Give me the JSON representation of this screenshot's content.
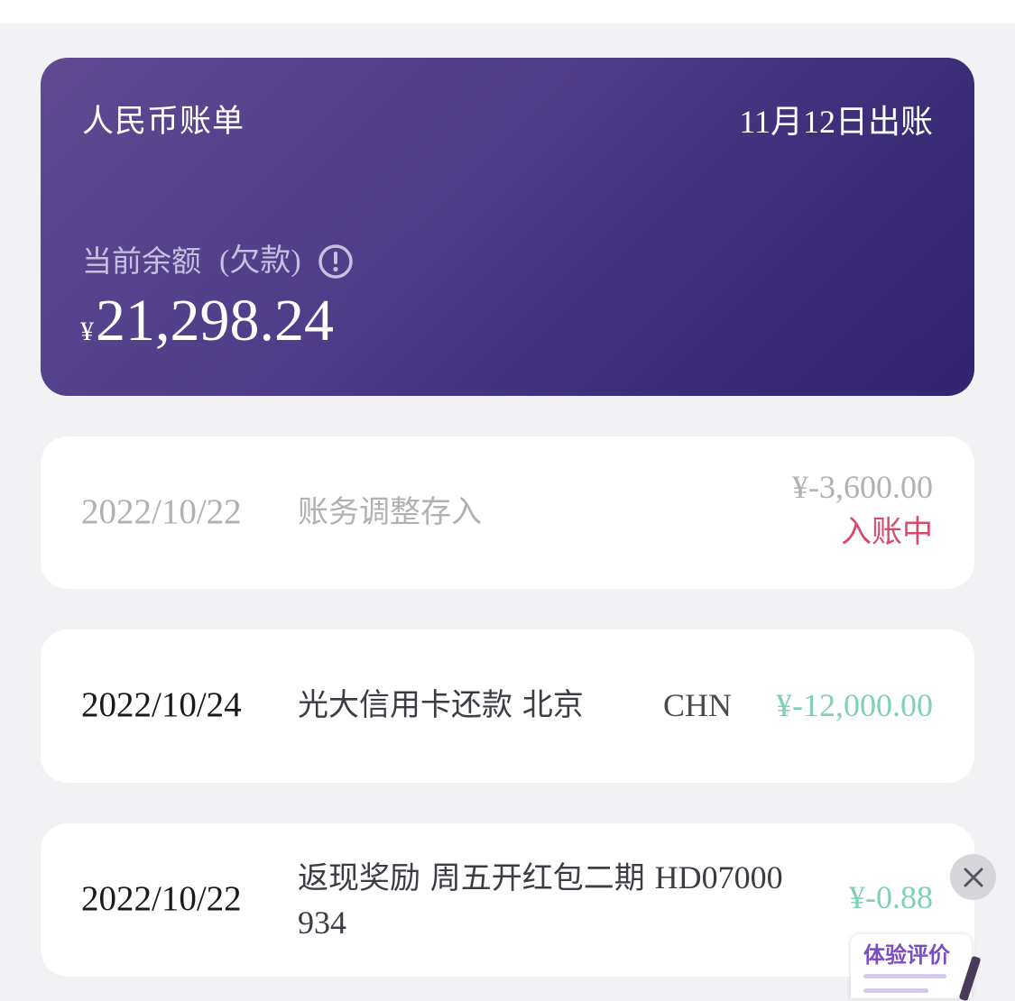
{
  "bill": {
    "title": "人民币账单",
    "statement_date": "11月12日出账",
    "balance_label": "当前余额",
    "balance_note": "(欠款)",
    "currency_symbol": "¥",
    "balance_amount": "21,298.24",
    "info_icon": "info-circle-icon"
  },
  "transactions": [
    {
      "date": "2022/10/22",
      "description": "账务调整存入",
      "amount": "¥-3,600.00",
      "status": "入账中",
      "region": ""
    },
    {
      "date": "2022/10/24",
      "description": "光大信用卡还款 北京",
      "amount": "¥-12,000.00",
      "status": "",
      "region": "CHN"
    },
    {
      "date": "2022/10/22",
      "description_line1": "返现奖励 周五开红包二期",
      "description_code": "HD07000",
      "description_line2": "934",
      "amount": "¥-0.88",
      "status": "",
      "region": ""
    }
  ],
  "overlay": {
    "close_icon": "close-icon",
    "feedback_label": "体验评价"
  },
  "colors": {
    "card_gradient_start": "#5f4a92",
    "card_gradient_end": "#32246f",
    "pending_text": "#b0b0b5",
    "status_red": "#d94a6a",
    "credit_green": "#7fd1b3",
    "date_text": "#1a1a1a",
    "feedback_purple": "#7b4cc4"
  }
}
